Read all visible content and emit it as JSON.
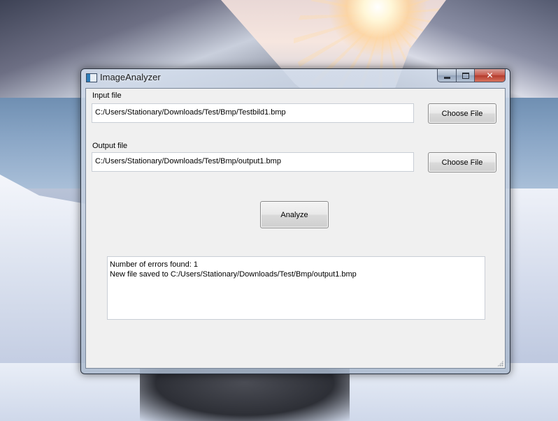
{
  "window": {
    "title": "ImageAnalyzer",
    "icon": "app-window-icon",
    "controls": [
      "minimize-icon",
      "maximize-icon",
      "close-icon"
    ]
  },
  "input": {
    "label": "Input file",
    "value": "C:/Users/Stationary/Downloads/Test/Bmp/Testbild1.bmp",
    "button_label": "Choose File"
  },
  "output": {
    "label": "Output file",
    "value": "C:/Users/Stationary/Downloads/Test/Bmp/output1.bmp",
    "button_label": "Choose File"
  },
  "analyze_button": "Analyze",
  "results": {
    "lines": [
      "Number of errors found: 1",
      "New file saved to C:/Users/Stationary/Downloads/Test/Bmp/output1.bmp"
    ]
  }
}
